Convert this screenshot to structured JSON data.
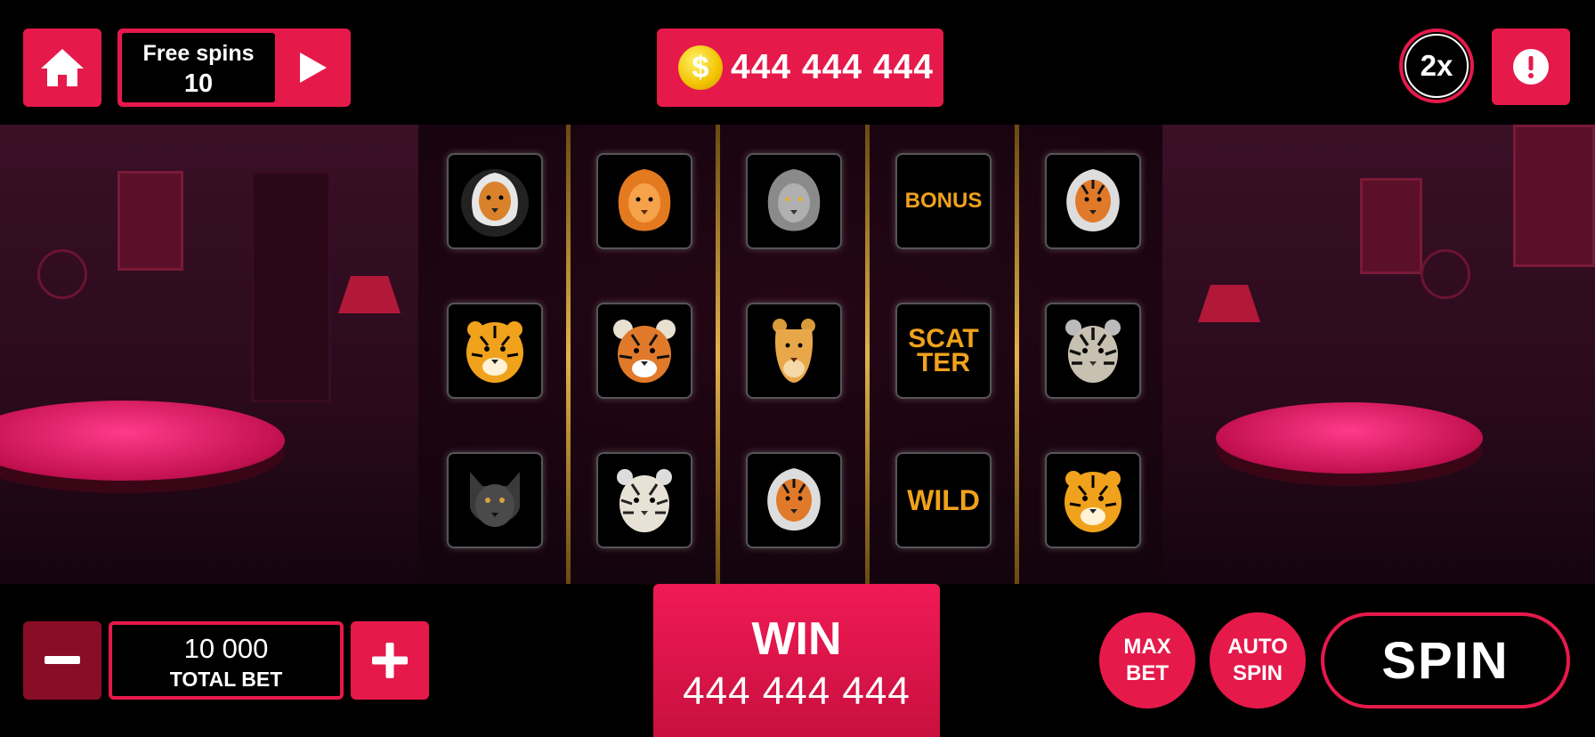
{
  "top_bar": {
    "free_spins_label": "Free spins",
    "free_spins_count": "10",
    "balance": "444 444 444",
    "coin_symbol": "$",
    "multiplier": "2x"
  },
  "reels": [
    [
      "lion-black-mane",
      "tiger-gold",
      "black-panther"
    ],
    [
      "lion-orange",
      "tiger-cub",
      "white-tiger"
    ],
    [
      "grey-lion",
      "lioness",
      "tiger-orange"
    ],
    [
      "BONUS",
      "SCATTER",
      "WILD"
    ],
    [
      "tiger-orange",
      "white-tiger-dark",
      "tiger-gold"
    ]
  ],
  "special_symbols": {
    "bonus": "BONUS",
    "scatter_line1": "SCAT",
    "scatter_line2": "TER",
    "wild": "WILD"
  },
  "bottom_bar": {
    "total_bet_value": "10 000",
    "total_bet_label": "TOTAL BET",
    "win_label": "WIN",
    "win_value": "444 444 444",
    "max_bet_line1": "MAX",
    "max_bet_line2": "BET",
    "auto_spin_line1": "AUTO",
    "auto_spin_line2": "SPIN",
    "spin_label": "SPIN"
  },
  "colors": {
    "accent": "#e6194b",
    "gold": "#e2b24a",
    "background": "#000000"
  }
}
